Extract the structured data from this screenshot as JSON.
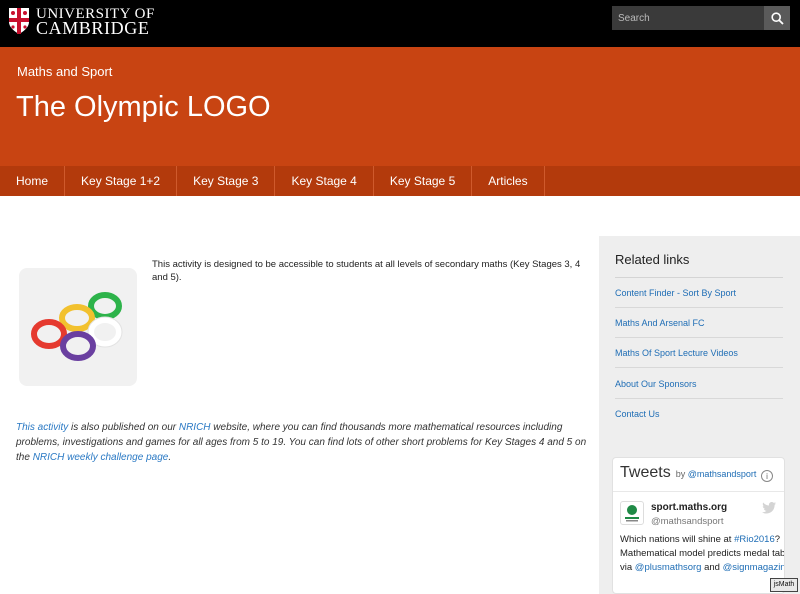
{
  "topbar": {
    "logo_line1": "UNIVERSITY OF",
    "logo_line2": "CAMBRIDGE",
    "search_placeholder": "Search"
  },
  "header": {
    "section": "Maths and Sport",
    "title": "The Olympic LOGO"
  },
  "nav": {
    "items": [
      {
        "label": "Home"
      },
      {
        "label": "Key Stage 1+2"
      },
      {
        "label": "Key Stage 3"
      },
      {
        "label": "Key Stage 4"
      },
      {
        "label": "Key Stage 5"
      },
      {
        "label": "Articles"
      }
    ]
  },
  "content": {
    "intro": "This activity is designed to be accessible to students at all levels of secondary maths (Key Stages 3, 4 and 5).",
    "para": {
      "link1": "This activity",
      "t1": " is also published on our ",
      "link2": "NRICH",
      "t2": " website, where you can find thousands more mathematical resources including problems, investigations and games for all ages from 5 to 19. You can find lots of other short problems for Key Stages 4 and 5 on the ",
      "link3": "NRICH weekly challenge page",
      "t3": "."
    },
    "ring_colors": [
      "#2db34a",
      "#f2c12e",
      "#e53a2f",
      "#ffffff",
      "#6a3fa0"
    ]
  },
  "sidebar": {
    "title": "Related links",
    "links": [
      {
        "label": "Content Finder - Sort By Sport"
      },
      {
        "label": "Maths And Arsenal FC"
      },
      {
        "label": "Maths Of Sport Lecture Videos"
      },
      {
        "label": "About Our Sponsors"
      },
      {
        "label": "Contact Us"
      }
    ]
  },
  "tweets": {
    "title": "Tweets",
    "by": "by",
    "by_handle": "@mathsandsport",
    "account_name": "sport.maths.org",
    "account_handle": "@mathsandsport",
    "text": {
      "t1": "Which nations will shine at ",
      "tag1": "#Rio2016",
      "t2": "? Mathematical model predicts medal table, via ",
      "tag2": "@plusmathsorg",
      "t3": " and ",
      "tag3": "@signmagazine"
    }
  },
  "badge": "jsMath",
  "colors": {
    "header_bg": "#c84412",
    "nav_bg": "#b33a0c",
    "link": "#1e6db5"
  }
}
